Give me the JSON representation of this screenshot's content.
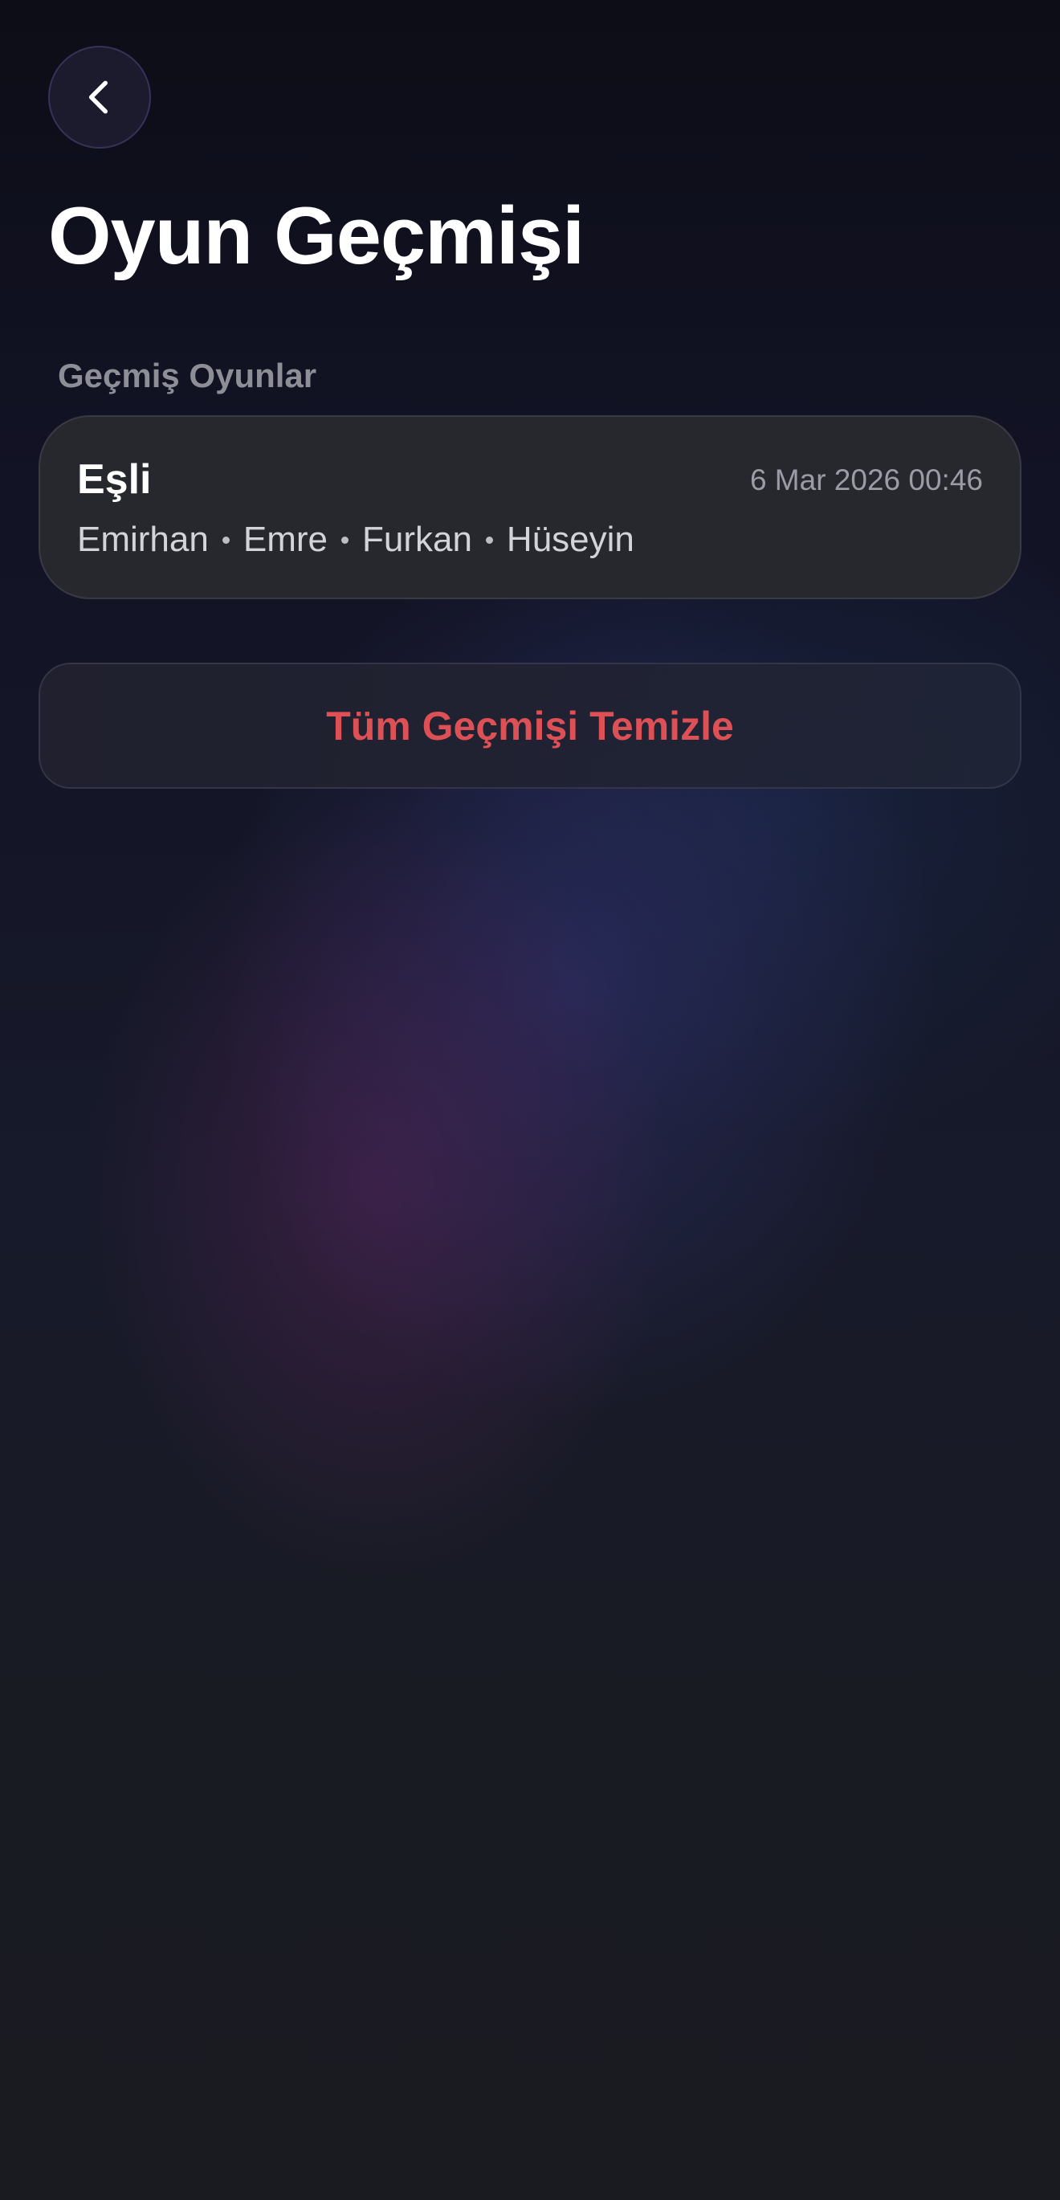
{
  "header": {
    "back_icon": "chevron-left-icon",
    "title": "Oyun Geçmişi"
  },
  "section": {
    "label": "Geçmiş Oyunlar"
  },
  "games": [
    {
      "mode": "Eşli",
      "date": "6 Mar 2026 00:46",
      "players": [
        "Emirhan",
        "Emre",
        "Furkan",
        "Hüseyin"
      ]
    }
  ],
  "actions": {
    "clear_label": "Tüm Geçmişi Temizle"
  },
  "colors": {
    "background": "#0f101a",
    "card": "#27272e",
    "danger": "#dd5055",
    "muted": "#8e8e97"
  }
}
